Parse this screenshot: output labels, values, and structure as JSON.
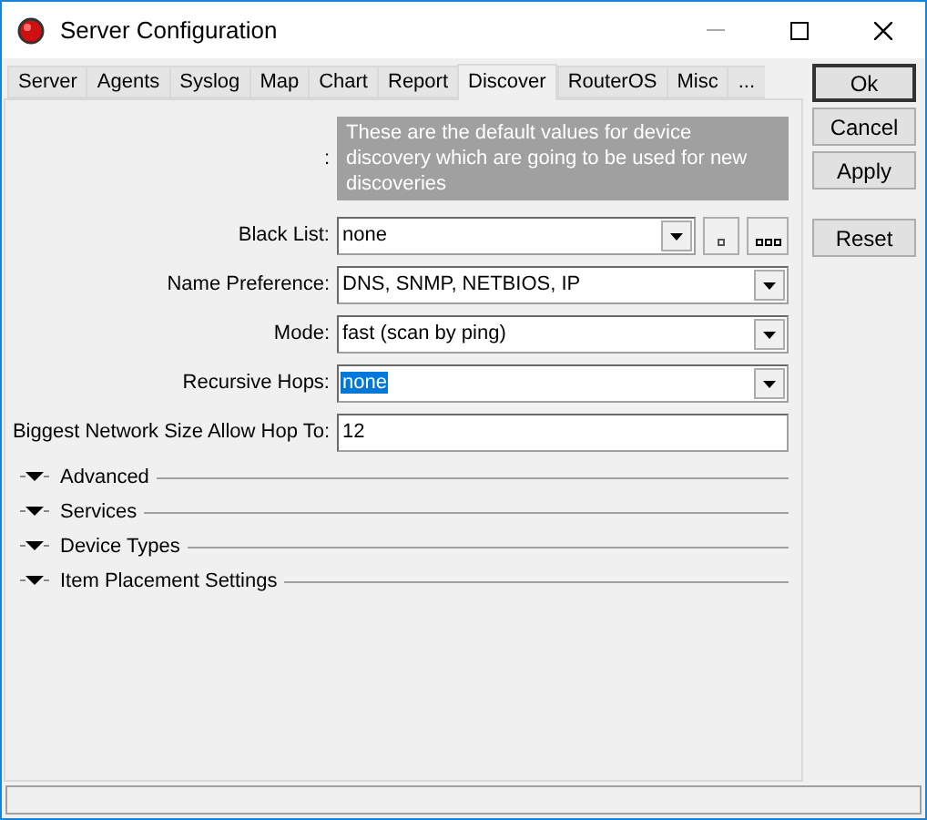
{
  "window": {
    "title": "Server Configuration"
  },
  "tabs": [
    {
      "label": "Server",
      "selected": false
    },
    {
      "label": "Agents",
      "selected": false
    },
    {
      "label": "Syslog",
      "selected": false
    },
    {
      "label": "Map",
      "selected": false
    },
    {
      "label": "Chart",
      "selected": false
    },
    {
      "label": "Report",
      "selected": false
    },
    {
      "label": "Discover",
      "selected": true
    },
    {
      "label": "RouterOS",
      "selected": false
    },
    {
      "label": "Misc",
      "selected": false
    },
    {
      "label": "...",
      "selected": false
    }
  ],
  "info": {
    "label": ":",
    "text": "These are the default values for device discovery which are going to be used for new discoveries"
  },
  "fields": [
    {
      "kind": "combo_buttons",
      "label": "Black List:",
      "value": "none",
      "text_selected": false
    },
    {
      "kind": "combo",
      "label": "Name Preference:",
      "value": "DNS, SNMP, NETBIOS, IP",
      "text_selected": false
    },
    {
      "kind": "combo",
      "label": "Mode:",
      "value": "fast (scan by ping)",
      "text_selected": false
    },
    {
      "kind": "combo",
      "label": "Recursive Hops:",
      "value": "none",
      "text_selected": true
    },
    {
      "kind": "text",
      "label": "Biggest Network Size Allow Hop To:",
      "value": "12",
      "text_selected": false
    }
  ],
  "sections": [
    {
      "label": "Advanced",
      "expanded": false
    },
    {
      "label": "Services",
      "expanded": false
    },
    {
      "label": "Device Types",
      "expanded": false
    },
    {
      "label": "Item Placement Settings",
      "expanded": false
    }
  ],
  "button_groups": [
    {
      "buttons": [
        {
          "label": "Ok",
          "default": true
        },
        {
          "label": "Cancel",
          "default": false
        },
        {
          "label": "Apply",
          "default": false
        }
      ]
    },
    {
      "buttons": [
        {
          "label": "Reset",
          "default": false
        }
      ]
    }
  ]
}
